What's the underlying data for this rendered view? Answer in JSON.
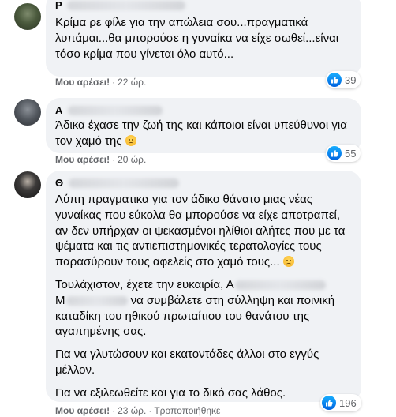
{
  "comments": [
    {
      "name_visible": "Ρ",
      "paragraphs": [
        "Κρίμα ρε φίλε για την απώλεια σου...πραγματικά λυπάμαι...θα μπορούσε η γυναίκα να είχε σωθεί...είναι τόσο κρίμα που γίνεται όλο αυτό..."
      ],
      "like_label": "Μου αρέσει!",
      "time": "22 ώρ.",
      "reaction_count": "39"
    },
    {
      "name_visible": "Α",
      "paragraphs": [
        "Άδικα έχασε την ζωή της και κάποιοι είναι υπεύθυνοι για τον χαμό της"
      ],
      "like_label": "Μου αρέσει!",
      "time": "20 ώρ.",
      "reaction_count": "55"
    },
    {
      "name_visible": "Θ",
      "paragraphs": [
        "Λύπη πραγματικα για τον άδικο θάνατο μιας νέας γυναίκας που εύκολα θα μπορούσε να είχε αποτραπεί, αν δεν υπήρχαν οι ψεκασμένοι ηλίθιοι αλήτες που με τα ψέματα και τις αντιεπιστημονικές τερατολογίες τους παρασύρουν τους αφελείς στο χαμό τους...",
        "Τουλάχιστον, έχετε την ευκαιρία, Α",
        "να συμβάλετε στη σύλληψη και ποινική καταδίκη του ηθικού πρωταίτιου του θανάτου της αγαπημένης σας.",
        "Για να γλυτώσουν και εκατοντάδες άλλοι στο εγγύς μέλλον.",
        "Για να εξιλεωθείτε και για το δικό σας λάθος."
      ],
      "paragraph2_line1_prefix": "Τουλάχιστον, έχετε την ευκαιρία, Α",
      "paragraph2_line2_prefix": "Μ",
      "paragraph2_line2_rest": "να συμβάλετε στη σύλληψη και ποινική",
      "paragraph2_rest": "καταδίκη του ηθικού πρωταίτιου του θανάτου της αγαπημένης σας.",
      "like_label": "Μου αρέσει!",
      "time": "23 ώρ.",
      "edited_label": "Τροποποιήθηκε",
      "reaction_count": "196"
    }
  ],
  "colors": {
    "bubble": "#f0f2f5",
    "meta_text": "#65676b",
    "like_blue": "#1877f2"
  }
}
